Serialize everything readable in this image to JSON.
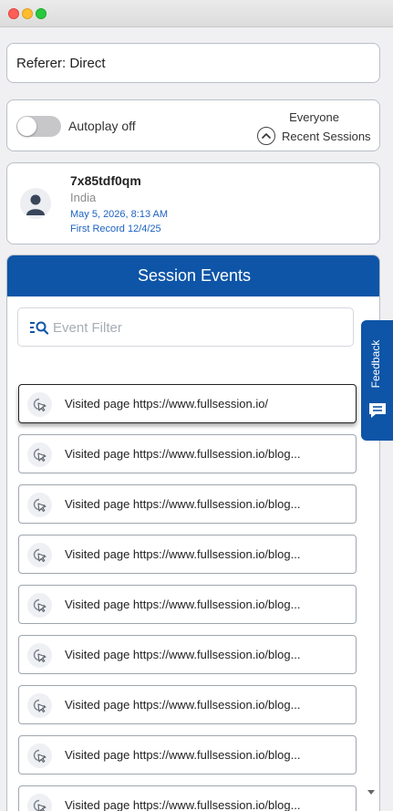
{
  "window": {
    "controls": [
      "close",
      "minimize",
      "maximize"
    ]
  },
  "referer": {
    "text": "Referer: Direct"
  },
  "autoplay": {
    "label": "Autoplay off",
    "enabled": false,
    "audience": "Everyone",
    "recent_label": "Recent Sessions",
    "recent_icon": "chevron-up-circle-icon"
  },
  "user": {
    "id": "7x85tdf0qm",
    "country": "India",
    "date": "May 5, 2026, 8:13 AM",
    "first_record": "First Record 12/4/25",
    "avatar_icon": "user-icon"
  },
  "events": {
    "title": "Session Events",
    "filter_placeholder": "Event Filter",
    "filter_icon": "search-filter-icon",
    "event_icon": "cursor-click-icon",
    "items": [
      {
        "label": "Visited page https://www.fullsession.io/",
        "active": true
      },
      {
        "label": "Visited page https://www.fullsession.io/blog...",
        "active": false
      },
      {
        "label": "Visited page https://www.fullsession.io/blog...",
        "active": false
      },
      {
        "label": "Visited page https://www.fullsession.io/blog...",
        "active": false
      },
      {
        "label": "Visited page https://www.fullsession.io/blog...",
        "active": false
      },
      {
        "label": "Visited page https://www.fullsession.io/blog...",
        "active": false
      },
      {
        "label": "Visited page https://www.fullsession.io/blog...",
        "active": false
      },
      {
        "label": "Visited page https://www.fullsession.io/blog...",
        "active": false
      },
      {
        "label": "Visited page https://www.fullsession.io/blog...",
        "active": false
      }
    ]
  },
  "feedback": {
    "label": "Feedback",
    "icon": "message-icon"
  },
  "colors": {
    "accent": "#0e55a7",
    "link": "#1e62c0"
  }
}
